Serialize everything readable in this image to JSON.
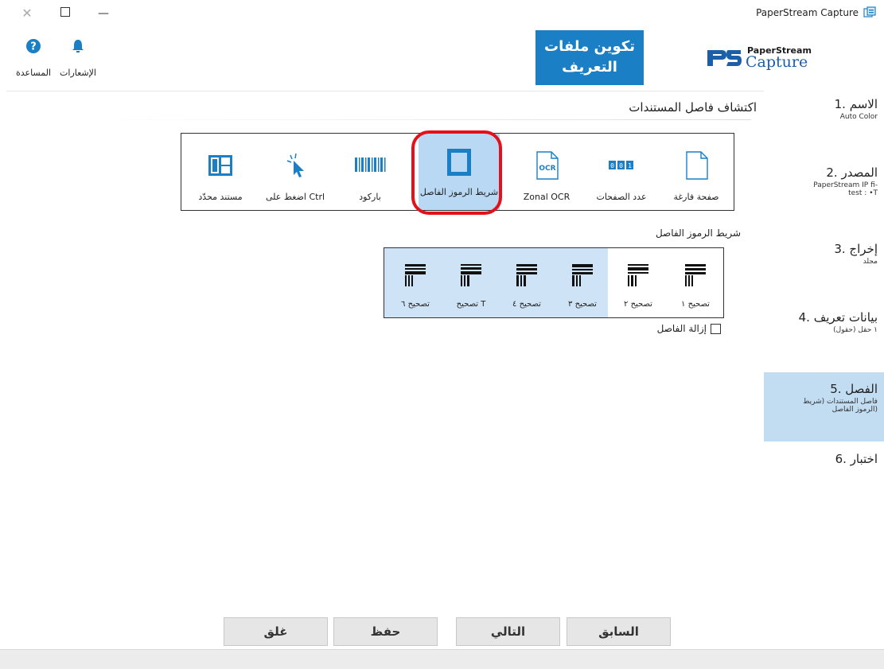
{
  "window": {
    "title": "PaperStream Capture"
  },
  "header": {
    "help_label": "المساعدة",
    "notifications_label": "الإشعارات",
    "profile_button_line1": "تكوين ملفات",
    "profile_button_line2": "التعريف",
    "logo_small": "PaperStream",
    "logo_big": "Capture"
  },
  "sidebar": {
    "items": [
      {
        "title": "1. الاسم",
        "sub": "Auto Color"
      },
      {
        "title": "2. المصدر",
        "sub": "PaperStream IP fi-",
        "sub2": "test : •T"
      },
      {
        "title": "3. إخراج",
        "sub": "مجلد"
      },
      {
        "title": "4. بيانات تعريف",
        "sub": "١ حقل (حقول)"
      },
      {
        "title": "5. الفصل",
        "sub": "فاصل المستندات (شريط",
        "sub2": "الرموز الفاصل)"
      },
      {
        "title": "6. اختبار",
        "sub": ""
      }
    ],
    "active_index": 4
  },
  "main": {
    "section_title": "اكتشاف فاصل المستندات",
    "types": [
      {
        "label": "صفحة فارغة",
        "icon": "blank-page-icon"
      },
      {
        "label": "عدد الصفحات",
        "icon": "page-count-icon"
      },
      {
        "label": "Zonal OCR",
        "icon": "ocr-icon"
      },
      {
        "label": "شريط الرموز الفاصل",
        "icon": "patch-code-icon",
        "selected": true
      },
      {
        "label": "باركود",
        "icon": "barcode-icon"
      },
      {
        "label": "اضغط على Ctrl",
        "icon": "cursor-icon"
      },
      {
        "label": "مستند محدّد",
        "icon": "fixed-document-icon"
      }
    ],
    "patch_title": "شريط الرموز الفاصل",
    "patches": [
      {
        "label": "تصحيح ١"
      },
      {
        "label": "تصحيح ٢"
      },
      {
        "label": "تصحيح ٣"
      },
      {
        "label": "تصحيح ٤"
      },
      {
        "label": "تصحيح T"
      },
      {
        "label": "تصحيح ٦"
      }
    ],
    "remove_separator_label": "إزالة الفاصل"
  },
  "buttons": {
    "back": "السابق",
    "next": "التالي",
    "save": "حفظ",
    "close": "غلق"
  },
  "colors": {
    "accent": "#1a7fc4",
    "selected_bg": "#b9d8f3",
    "sidebar_active": "#c2dcf2",
    "highlight_ring": "#e3111b"
  }
}
